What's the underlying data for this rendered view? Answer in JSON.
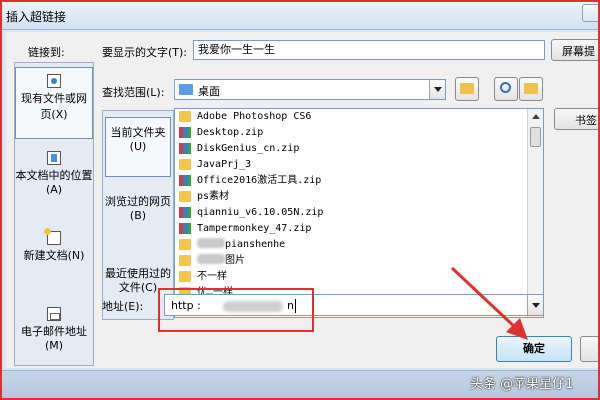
{
  "window": {
    "title": "插入超链接"
  },
  "linkto": {
    "label": "链接到:",
    "items": [
      {
        "label": "现有文件或网页(X)",
        "icon": "existing-file-icon"
      },
      {
        "label": "本文档中的位置(A)",
        "icon": "document-place-icon"
      },
      {
        "label": "新建文档(N)",
        "icon": "new-document-icon"
      },
      {
        "label": "电子邮件地址(M)",
        "icon": "email-icon"
      }
    ]
  },
  "display_text": {
    "label": "要显示的文字(T):",
    "value": "我爱你一生一生"
  },
  "screentip_label": "屏幕提",
  "lookin": {
    "label": "查找范围(L):",
    "value": "桌面"
  },
  "subnav": {
    "current": "当前文件夹(U)",
    "browsed": "浏览过的网页(B)",
    "recent": "最近使用过的文件(C)"
  },
  "files": [
    {
      "name": "Adobe Photoshop CS6",
      "kind": "folder"
    },
    {
      "name": "Desktop.zip",
      "kind": "zip"
    },
    {
      "name": "DiskGenius_cn.zip",
      "kind": "zip"
    },
    {
      "name": "JavaPrj_3",
      "kind": "folder"
    },
    {
      "name": "Office2016激活工具.zip",
      "kind": "zip"
    },
    {
      "name": "ps素材",
      "kind": "folder"
    },
    {
      "name": "qianniu_v6.10.05N.zip",
      "kind": "zip"
    },
    {
      "name": "Tampermonkey_47.zip",
      "kind": "zip"
    },
    {
      "name": "pianshenhe",
      "kind": "folder"
    },
    {
      "name": "图片",
      "kind": "folder"
    },
    {
      "name": "不一样",
      "kind": "folder"
    },
    {
      "name": "优…一样",
      "kind": "folder"
    }
  ],
  "bookmark_label": "书签",
  "address": {
    "label": "地址(E):",
    "value_prefix": "http :",
    "value_suffix": "n"
  },
  "ok_label": "确定",
  "watermark": "头条 @苹果星仔1",
  "colors": {
    "highlight": "#e03030",
    "accent": "#3c7fb1"
  }
}
